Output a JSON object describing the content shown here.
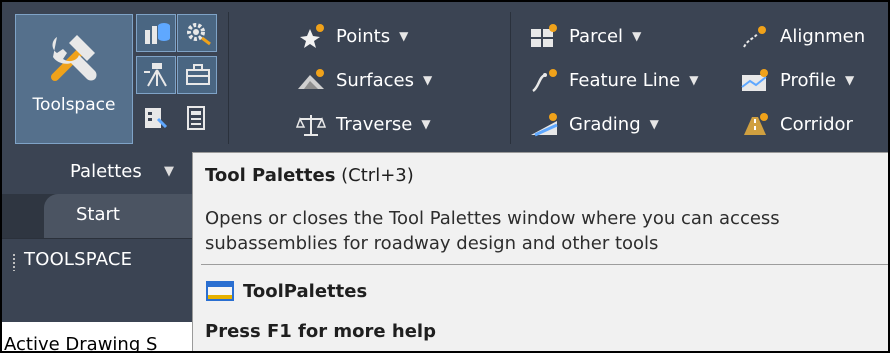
{
  "ribbon": {
    "toolspace_label": "Toolspace",
    "palettes_label": "Palettes",
    "items": {
      "points": "Points",
      "surfaces": "Surfaces",
      "traverse": "Traverse",
      "parcel": "Parcel",
      "feature_line": "Feature Line",
      "grading": "Grading",
      "alignment": "Alignmen",
      "profile": "Profile",
      "corridor": "Corridor"
    }
  },
  "tabs": {
    "start": "Start"
  },
  "panel": {
    "toolspace_title": "TOOLSPACE",
    "active_drawing": "Active Drawing S"
  },
  "tooltip": {
    "title": "Tool Palettes",
    "shortcut": "(Ctrl+3)",
    "description_line1": "Opens or closes the Tool Palettes window where you can access",
    "description_line2": "subassemblies for roadway design and other tools",
    "command": "ToolPalettes",
    "help": "Press F1 for more help"
  },
  "colors": {
    "ribbon_bg": "#3b4453",
    "active_button": "#55708c",
    "tooltip_bg": "#f1f1f1"
  }
}
